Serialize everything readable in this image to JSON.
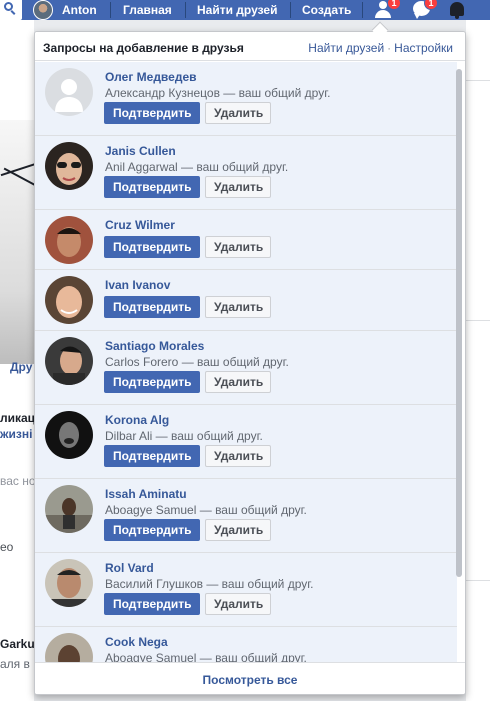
{
  "topbar": {
    "user_name": "Anton",
    "nav_home": "Главная",
    "nav_find_friends": "Найти друзей",
    "nav_create": "Создать",
    "friend_requests_badge": "1",
    "messages_badge": "1"
  },
  "background_fragments": {
    "tab_text": "Дру",
    "line1": "ликац",
    "line2": "жизні",
    "line3": "вас но",
    "line4": "ео",
    "line5": "Garku",
    "line6": "аля в"
  },
  "panel": {
    "title": "Запросы на добавление в друзья",
    "link_find_friends": "Найти друзей",
    "separator": "·",
    "link_settings": "Настройки",
    "footer": "Посмотреть все",
    "confirm_label": "Подтвердить",
    "delete_label": "Удалить",
    "requests": [
      {
        "name": "Олег Медведев",
        "mutual": "Александр Кузнецов — ваш общий друг."
      },
      {
        "name": "Janis Cullen",
        "mutual": "Anil Aggarwal — ваш общий друг."
      },
      {
        "name": "Cruz Wilmer",
        "mutual": ""
      },
      {
        "name": "Ivan Ivanov",
        "mutual": ""
      },
      {
        "name": "Santiago Morales",
        "mutual": "Carlos Forero — ваш общий друг."
      },
      {
        "name": "Korona Alg",
        "mutual": "Dilbar Ali — ваш общий друг."
      },
      {
        "name": "Issah Aminatu",
        "mutual": "Aboagye Samuel — ваш общий друг."
      },
      {
        "name": "Rol Vard",
        "mutual": "Василий Глушков — ваш общий друг."
      },
      {
        "name": "Cook Nega",
        "mutual": "Aboagye Samuel — ваш общий друг."
      }
    ]
  },
  "colors": {
    "brand": "#4267b2",
    "link": "#365899",
    "request_bg": "#edf2fa",
    "badge": "#fa3e3e"
  }
}
